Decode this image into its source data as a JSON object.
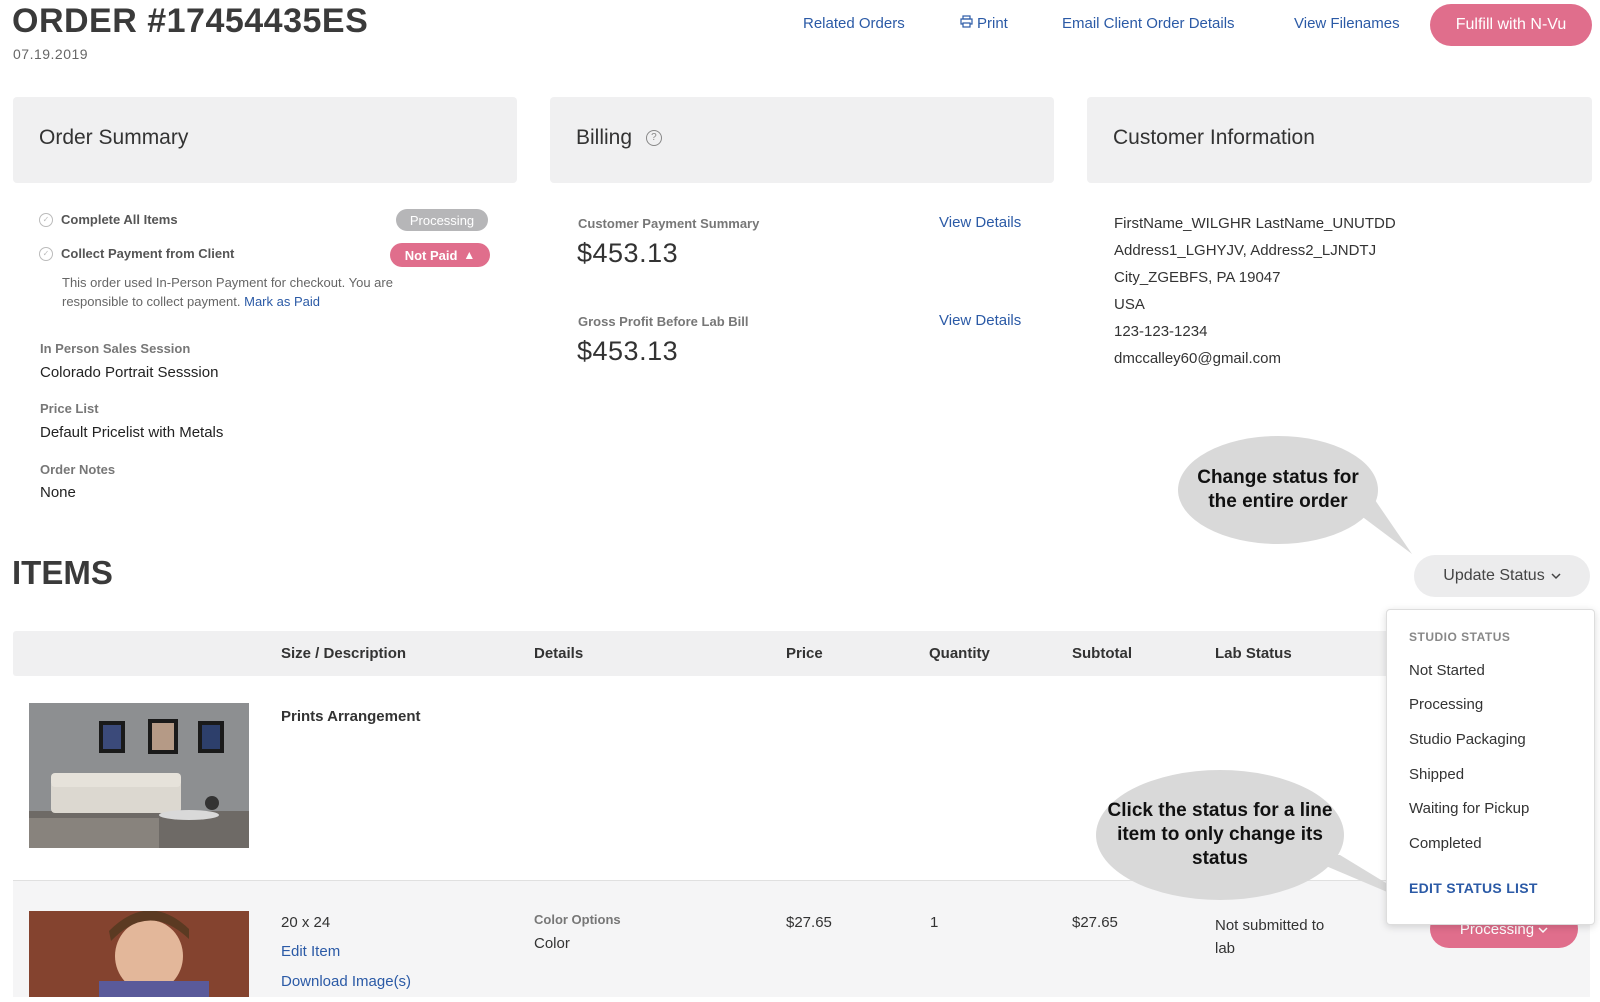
{
  "header": {
    "order_title": "ORDER #17454435ES",
    "date": "07.19.2019",
    "links": {
      "related_orders": "Related Orders",
      "print": "Print",
      "email_client": "Email Client Order Details",
      "view_filenames": "View Filenames"
    },
    "fulfill_button": "Fulfill with N-Vu"
  },
  "order_summary": {
    "title": "Order Summary",
    "task_complete_items": "Complete All Items",
    "task_complete_status": "Processing",
    "task_collect_payment": "Collect Payment from Client",
    "payment_status": "Not Paid",
    "payment_note": "This order used In-Person Payment for checkout. You are responsible to collect payment.",
    "mark_as_paid": "Mark as Paid",
    "session_label": "In Person Sales Session",
    "session_value": "Colorado Portrait Sesssion",
    "pricelist_label": "Price List",
    "pricelist_value": "Default Pricelist with Metals",
    "notes_label": "Order Notes",
    "notes_value": "None"
  },
  "billing": {
    "title": "Billing",
    "help_icon": "?",
    "payment_summary_label": "Customer Payment Summary",
    "payment_summary_value": "$453.13",
    "gross_profit_label": "Gross Profit Before Lab Bill",
    "gross_profit_value": "$453.13",
    "view_details": "View Details"
  },
  "customer": {
    "title": "Customer Information",
    "name": "FirstName_WILGHR LastName_UNUTDD",
    "address": "Address1_LGHYJV, Address2_LJNDTJ",
    "city": "City_ZGEBFS, PA 19047",
    "country": "USA",
    "phone": "123-123-1234",
    "email": "dmccalley60@gmail.com"
  },
  "callouts": {
    "order_status": "Change status for the entire order",
    "line_item_status": "Click the status for a line item to only change its status"
  },
  "items": {
    "title": "ITEMS",
    "update_status": "Update Status",
    "columns": [
      "Size / Description",
      "Details",
      "Price",
      "Quantity",
      "Subtotal",
      "Lab Status"
    ],
    "row1": {
      "description": "Prints Arrangement"
    },
    "row2": {
      "size": "20 x 24",
      "edit_item": "Edit Item",
      "download": "Download Image(s)",
      "details_label": "Color Options",
      "details_value": "Color",
      "price": "$27.65",
      "quantity": "1",
      "subtotal": "$27.65",
      "lab_status": "Not submitted to lab",
      "status_button": "Processing"
    }
  },
  "status_dropdown": {
    "heading": "STUDIO STATUS",
    "options": [
      "Not Started",
      "Processing",
      "Studio Packaging",
      "Shipped",
      "Waiting for Pickup",
      "Completed"
    ],
    "edit_link": "EDIT STATUS LIST"
  },
  "colors": {
    "accent_pink": "#e06e8c",
    "link_blue": "#2b5aa6",
    "panel_gray": "#f0f0f1"
  }
}
